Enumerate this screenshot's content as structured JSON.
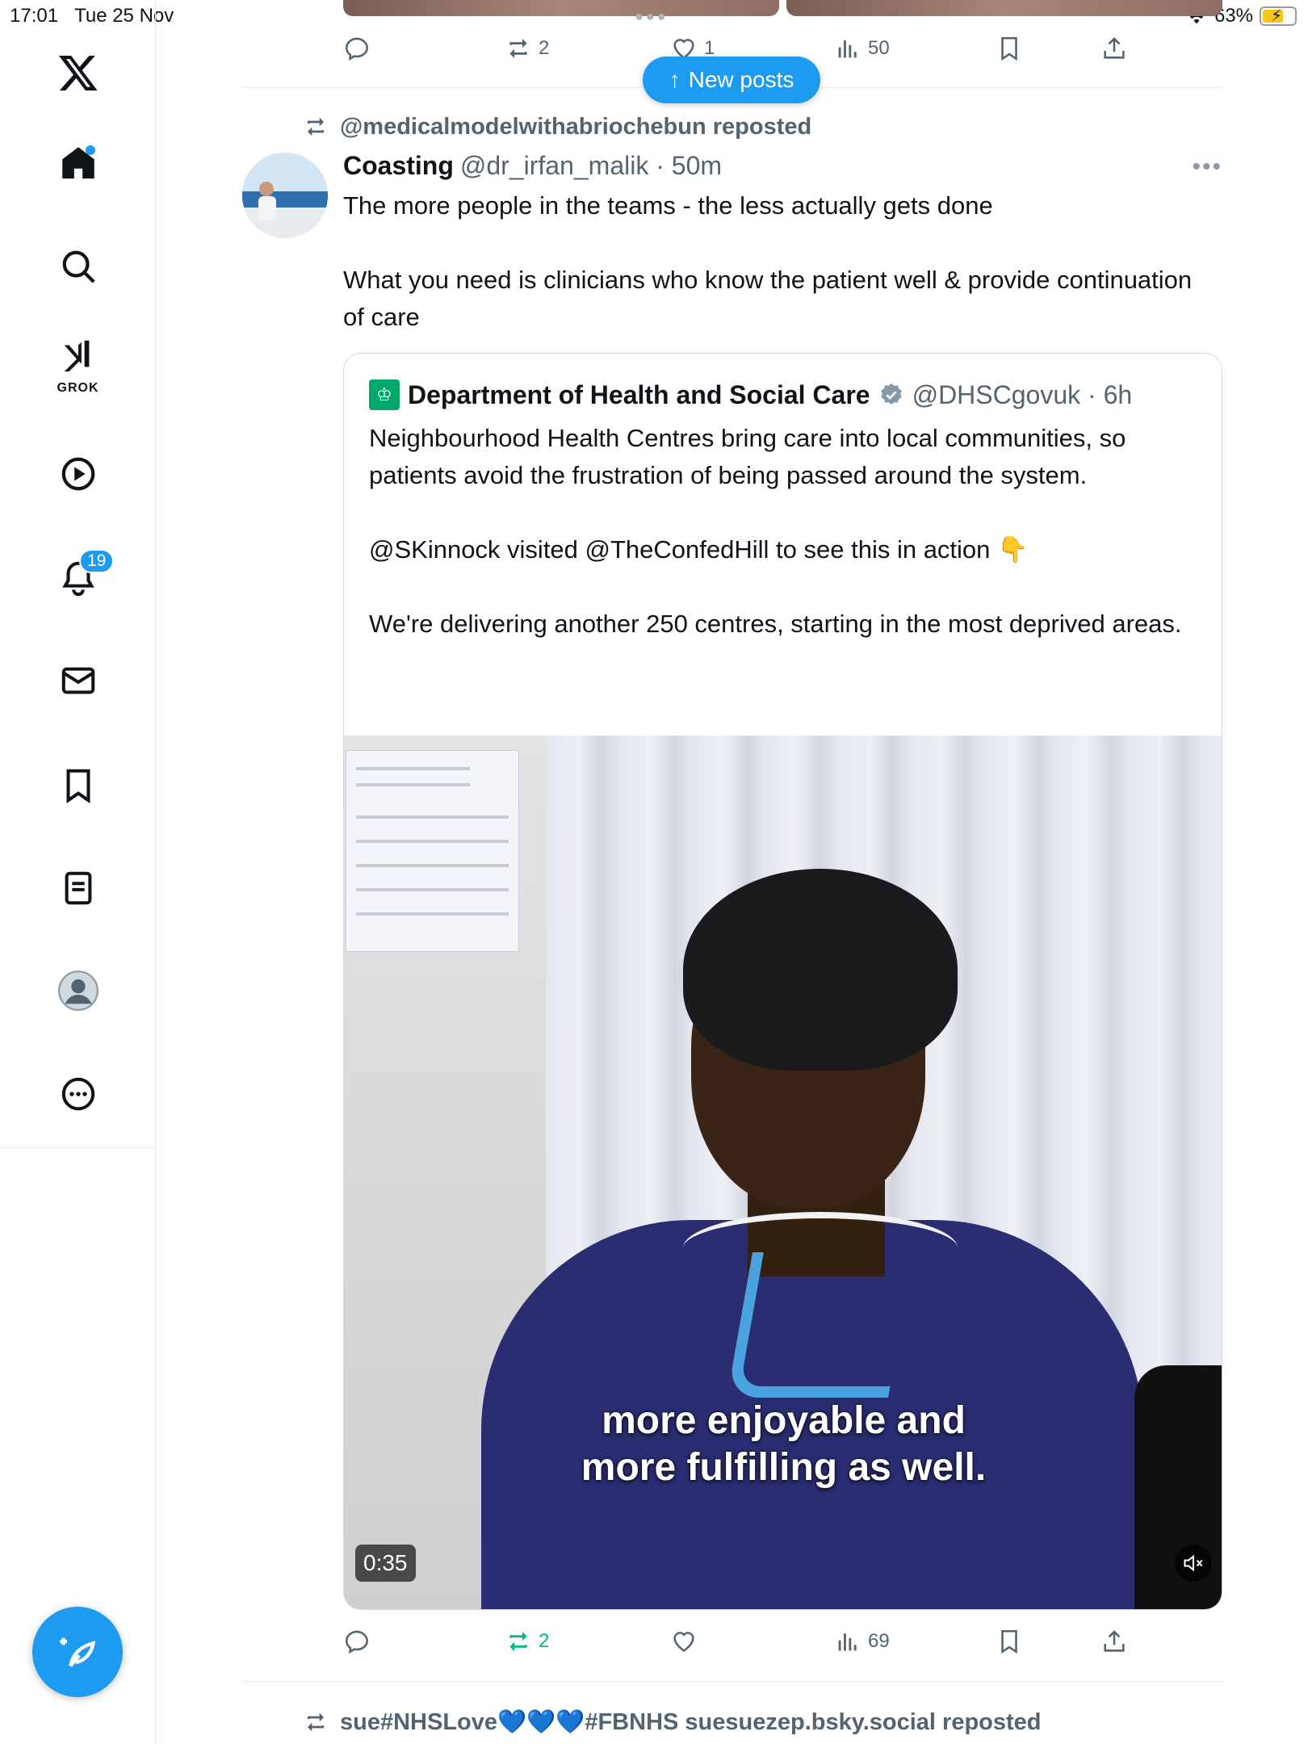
{
  "status": {
    "time": "17:01",
    "date": "Tue 25 Nov",
    "battery": "63%"
  },
  "sidebar": {
    "grok_label": "GROK",
    "notifications_badge": "19"
  },
  "prev_post": {
    "reposts": "2",
    "likes": "1",
    "views": "50"
  },
  "new_posts_label": "New posts",
  "post": {
    "reposted_by": "@medicalmodelwithabriochebun reposted",
    "author_name": "Coasting",
    "author_meta": "@dr_irfan_malik · 50m",
    "text_line1": "The more people in the teams - the less actually gets done",
    "text_line2": "What you need is clinicians who know the patient well & provide continuation of care",
    "reposts": "2",
    "views": "69"
  },
  "quote": {
    "author_name": "Department of Health and Social Care",
    "author_meta": "@DHSCgovuk · 6h",
    "para1": "Neighbourhood Health Centres bring care into local communities, so patients avoid the frustration of being passed around the system.",
    "para2": "@SKinnock visited @TheConfedHill to see this in action 👇",
    "para3": "We're delivering another 250 centres, starting in the most deprived areas.",
    "video": {
      "caption_line1": "more enjoyable and",
      "caption_line2": "more fulfilling as well.",
      "duration": "0:35"
    }
  },
  "next_post": {
    "reposted_by": "sue#NHSLove💙💙💙#FBNHS suesuezep.bsky.social reposted"
  },
  "colors": {
    "accent": "#1d9bf0",
    "repost_green": "#00ba7c",
    "muted_text": "#536471"
  }
}
